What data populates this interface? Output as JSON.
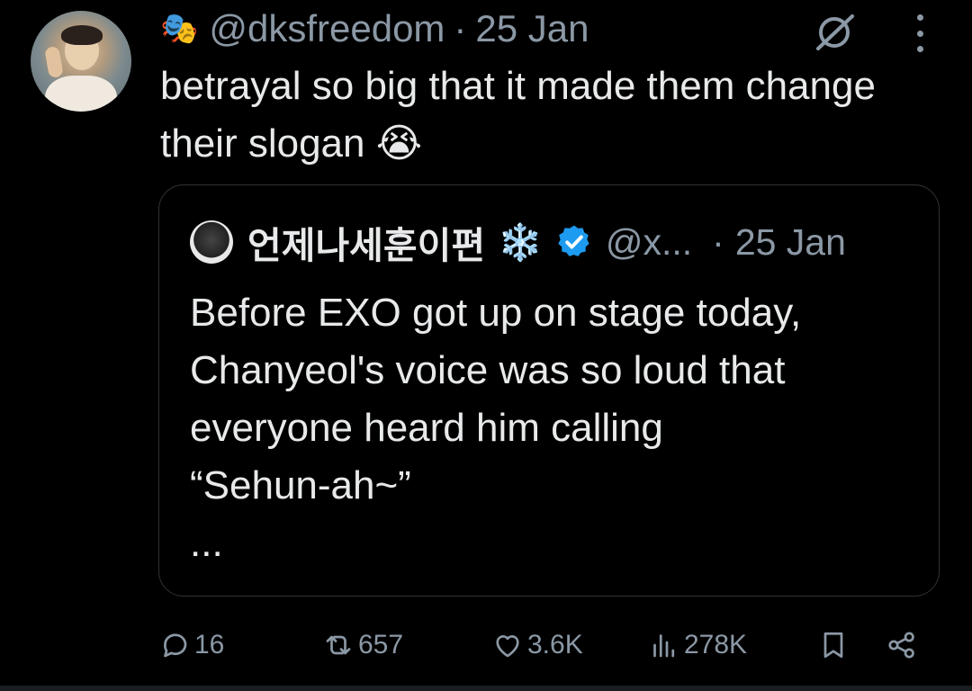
{
  "tweet": {
    "author_emoji": "🎭",
    "handle": "@dksfreedom",
    "separator": "·",
    "date": "25 Jan",
    "text": "betrayal so big that it made them change their slogan 😭"
  },
  "quote": {
    "name": "언제나세훈이편",
    "snow_emoji": "❄️",
    "handle": "@x...",
    "separator": "·",
    "date": "25 Jan",
    "text": "Before EXO got up on stage today,\nChanyeol's voice was so loud that\neveryone heard him calling\n“Sehun-ah~”\n..."
  },
  "actions": {
    "replies": "16",
    "reposts": "657",
    "likes": "3.6K",
    "views": "278K"
  },
  "colors": {
    "background": "#000000",
    "text": "#e7e9ea",
    "muted": "#8b98a5",
    "border": "#2f3336",
    "verified": "#1d9bf0"
  },
  "icons": [
    "grok-icon",
    "more-icon",
    "verified-icon",
    "reply-icon",
    "repost-icon",
    "like-icon",
    "views-icon",
    "bookmark-icon",
    "share-icon"
  ]
}
